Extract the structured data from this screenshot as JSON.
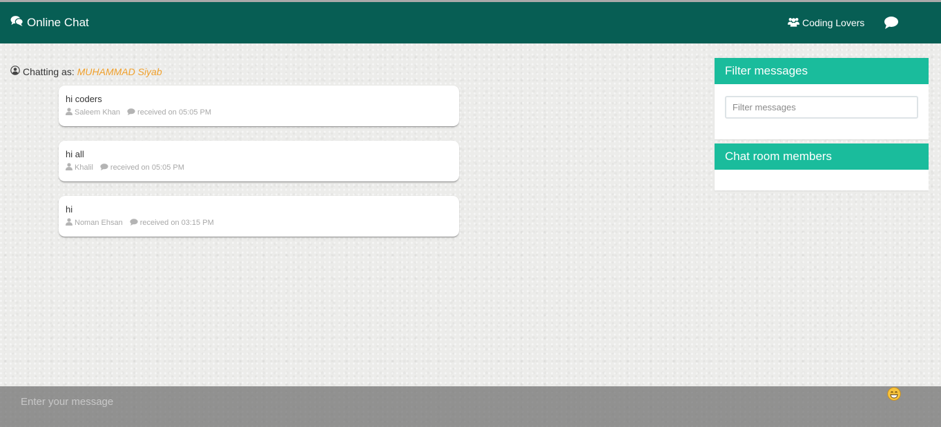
{
  "navbar": {
    "brand": "Online Chat",
    "room_name": "Coding Lovers",
    "background": "#075e54"
  },
  "chatting_as": {
    "label": "Chatting as:",
    "username": "MUHAMMAD Siyab",
    "username_color": "#f0a02c"
  },
  "messages": [
    {
      "text": "hi coders",
      "sender": "Saleem Khan",
      "received": "received on 05:05 PM"
    },
    {
      "text": "hi all",
      "sender": "Khalil",
      "received": "received on 05:05 PM"
    },
    {
      "text": "hi",
      "sender": "Noman Ehsan",
      "received": "received on 03:15 PM"
    }
  ],
  "filter_panel": {
    "title": "Filter messages",
    "placeholder": "Filter messages",
    "header_color": "#1abc9c"
  },
  "members_panel": {
    "title": "Chat room members",
    "members": []
  },
  "composer": {
    "placeholder": "Enter your message",
    "emoji_icon": "grinning-emoji-icon"
  }
}
